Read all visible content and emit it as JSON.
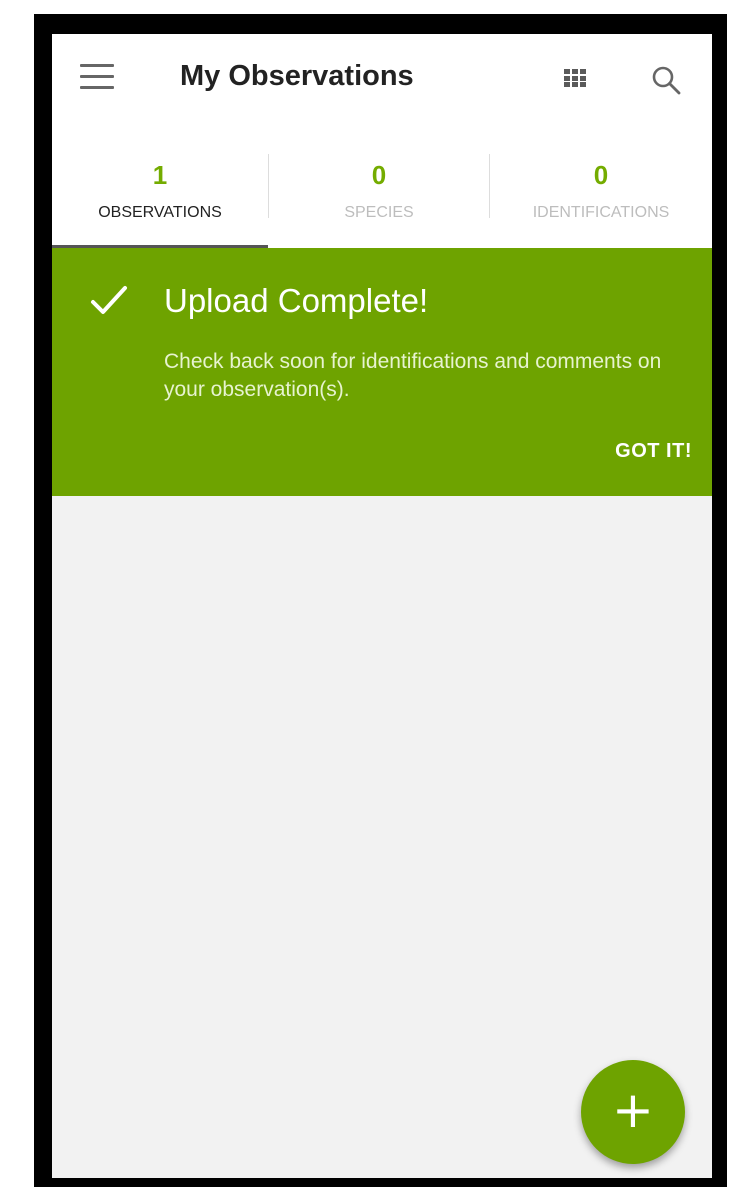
{
  "app_bar": {
    "title": "My Observations",
    "menu_icon": "hamburger-menu-icon",
    "grid_icon": "grid-view-icon",
    "search_icon": "search-icon"
  },
  "tabs": [
    {
      "count": "1",
      "label": "OBSERVATIONS",
      "active": true
    },
    {
      "count": "0",
      "label": "SPECIES",
      "active": false
    },
    {
      "count": "0",
      "label": "IDENTIFICATIONS",
      "active": false
    }
  ],
  "banner": {
    "icon": "checkmark-icon",
    "title": "Upload Complete!",
    "text": "Check back soon for identifications and comments on your observation(s).",
    "action_label": "GOT IT!"
  },
  "fab": {
    "icon": "plus-icon",
    "symbol": "+"
  },
  "colors": {
    "accent_green": "#6ea300",
    "count_green": "#74ac00",
    "background": "#f2f2f2"
  }
}
